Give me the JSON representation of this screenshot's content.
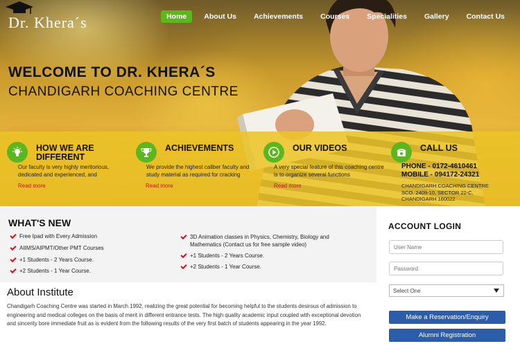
{
  "header": {
    "logo_text": "Dr. Khera´s",
    "nav": [
      "Home",
      "About Us",
      "Achievements",
      "Courses",
      "Specialities",
      "Gallery",
      "Contact Us"
    ],
    "active_nav": "Home"
  },
  "hero": {
    "title": "WELCOME TO DR. KHERA´S",
    "subtitle": "CHANDIGARH COACHING CENTRE"
  },
  "features": [
    {
      "icon": "lightbulb-icon",
      "title_line1": "HOW WE ARE",
      "title_line2": "DIFFERENT",
      "text": "Our faculty is very highly meritorious, dedicated and experienced, and",
      "link": "Read more"
    },
    {
      "icon": "trophy-icon",
      "title": "ACHIEVEMENTS",
      "text": "We provide the highest caliber faculty and study material as required for cracking",
      "link": "Read more"
    },
    {
      "icon": "play-icon",
      "title": "OUR VIDEOS",
      "text": "A very special feature of this coaching centre is to organize several functions",
      "link": "Read more"
    },
    {
      "icon": "phone-icon",
      "title": "CALL US",
      "phone": "PHONE - 0172-4610461",
      "mobile": "MOBILE - 094172-24321",
      "address": [
        "CHANDIGARH COACHING CENTRE",
        "SCO. 2409-10, SECTOR 22-C,",
        "CHANDIGARH 160022"
      ]
    }
  ],
  "whats_new": {
    "title": "WHAT'S NEW",
    "left_items": [
      "Free Ipad with Every Admission",
      "AIIMS/AIPMT/Other PMT Courses",
      "+1 Students - 2 Years Course.",
      "+2 Students - 1 Year Course."
    ],
    "right_items": [
      "3D Animation classes in Physics, Chemistry, Biology and Mathematics (Contact us for free sample video)",
      "+1 Students - 2 Years Course.",
      "+2 Students - 1 Year Course."
    ]
  },
  "about": {
    "title": "About Institute",
    "text": "Chandigarh Coaching Centre was started in March 1992, realizing the great potential for becoming helpful to the students desirous of admission to engineering and medical colleges on the basis of merit in different entrance tests. The high quality academic input coupled with exceptional devotion and sincerity bore immediate fruit as is evident from the following results of the very first batch of students appearing in the year 1992."
  },
  "login": {
    "title": "ACCOUNT LOGIN",
    "username_placeholder": "User Name",
    "password_placeholder": "Password",
    "select_value": "Select One",
    "reserve_button": "Make a Reservation/Enquiry",
    "alumni_button": "Alumni Registration"
  },
  "colors": {
    "accent_green": "#5cb71f",
    "strip_yellow": "#ecc428",
    "link_red": "#c8141a",
    "button_blue": "#2b5dab"
  }
}
